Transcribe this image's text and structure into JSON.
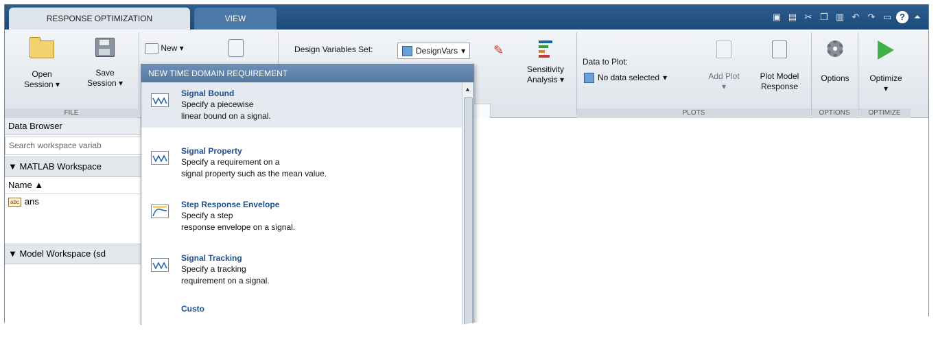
{
  "tabs": {
    "active": "RESPONSE OPTIMIZATION",
    "view": "VIEW"
  },
  "qat": {
    "help": "?"
  },
  "file": {
    "open_label": "Open",
    "open_sub": "Session ▾",
    "save_label": "Save",
    "save_sub": "Session ▾",
    "group": "FILE"
  },
  "requirements": {
    "new_label": "New ▾"
  },
  "design_vars": {
    "label": "Design Variables Set:",
    "value": "DesignVars"
  },
  "sensitivity": {
    "line1": "Sensitivity",
    "line2": "Analysis ▾"
  },
  "plots": {
    "data_to_plot_label": "Data to Plot:",
    "data_value": "No data selected",
    "add_plot_label": "Add Plot",
    "plot_model_line1": "Plot Model",
    "plot_model_line2": "Response",
    "group": "PLOTS"
  },
  "options": {
    "label": "Options",
    "group": "OPTIONS"
  },
  "optimize": {
    "label": "Optimize",
    "group": "OPTIMIZE"
  },
  "sidebar": {
    "title": "Data Browser",
    "search_placeholder": "Search workspace variab",
    "matlab_ws": "▼ MATLAB Workspace",
    "name_col": "Name ▲",
    "var_icon": "abc",
    "var1": "ans",
    "model_ws": "▼ Model Workspace (sd"
  },
  "menu": {
    "header": "NEW TIME DOMAIN REQUIREMENT",
    "items": [
      {
        "title": "Signal Bound",
        "desc1": "Specify a piecewise",
        "desc2": "linear bound on a signal."
      },
      {
        "title": "Signal Property",
        "desc1": "Specify a requirement on a",
        "desc2": "signal property such as the mean value."
      },
      {
        "title": "Step Response Envelope",
        "desc1": "Specify a step",
        "desc2": "response envelope on a signal."
      },
      {
        "title": "Signal Tracking",
        "desc1": "Specify a tracking",
        "desc2": "requirement on a signal."
      },
      {
        "title": "Custo"
      }
    ]
  }
}
